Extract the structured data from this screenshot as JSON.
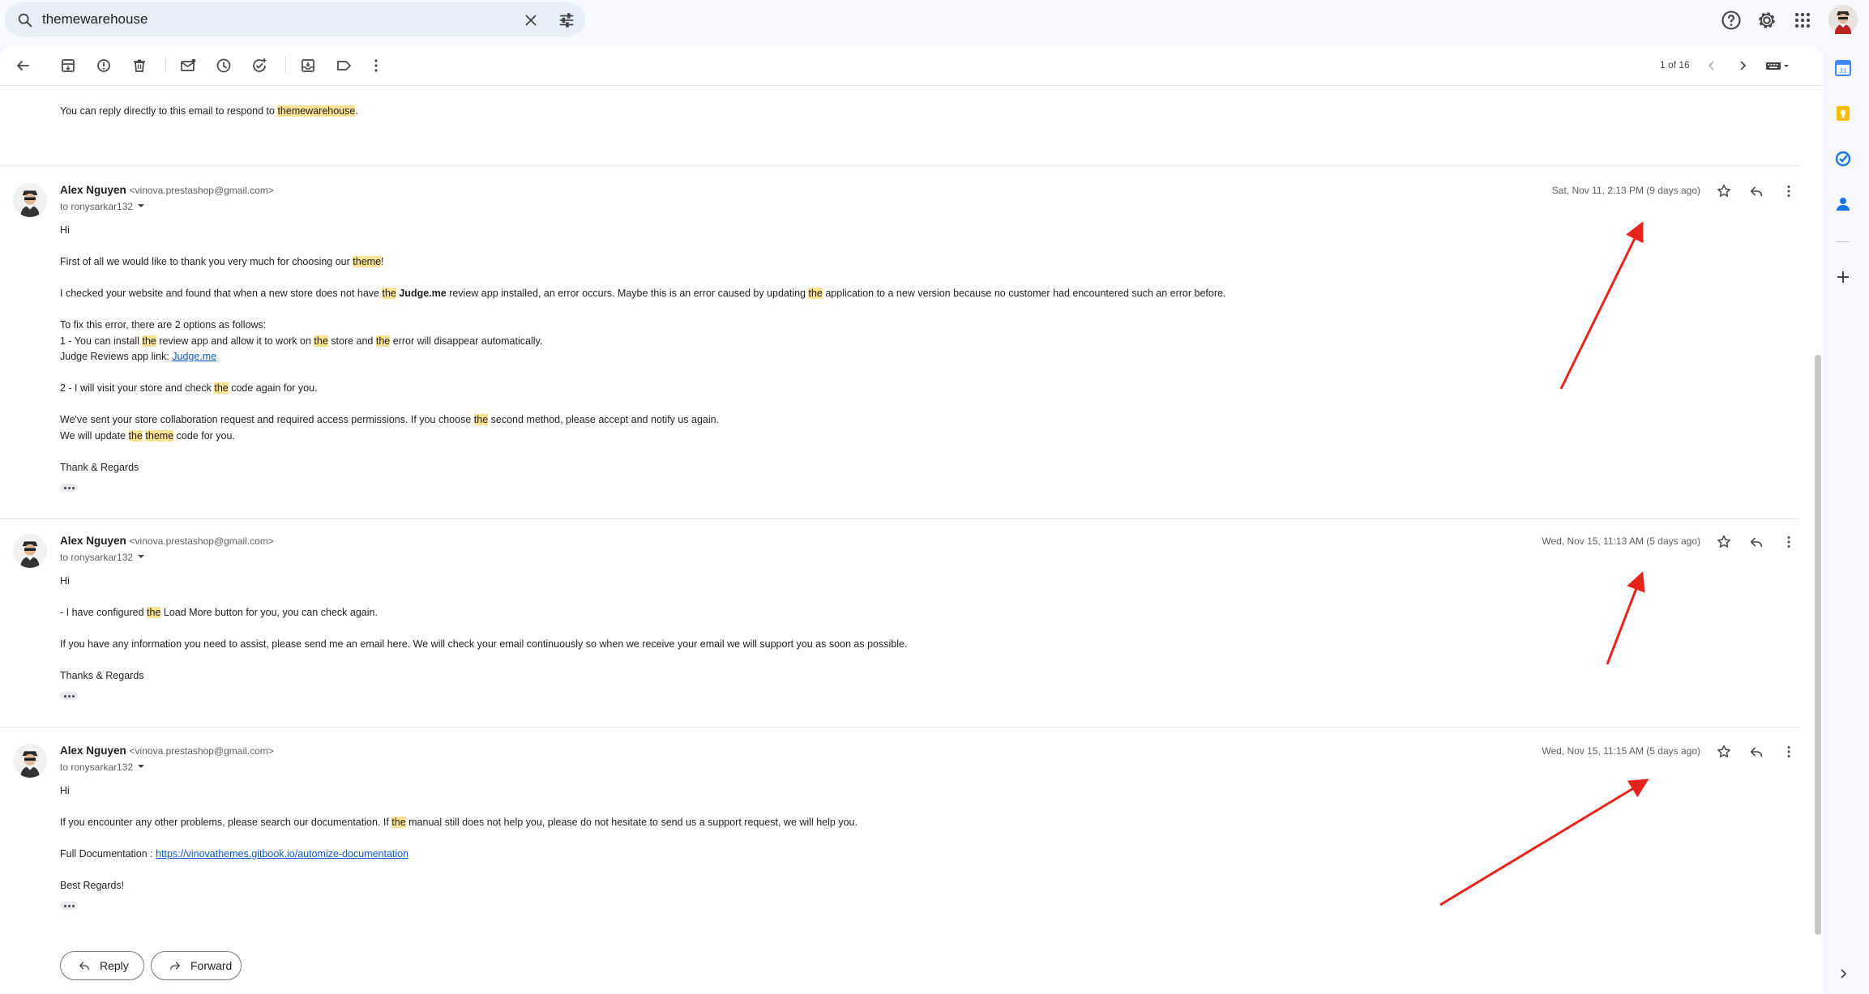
{
  "search": {
    "query": "themewarehouse"
  },
  "toolbar": {
    "pager": "1 of 16"
  },
  "colors": {
    "highlight": "#fde293",
    "link": "#0b57d0",
    "annotation_arrow": "#e8231c"
  },
  "intro": {
    "prefix": "You can reply directly to this email to respond to ",
    "keyword": "themewarehouse",
    "suffix": "."
  },
  "messages": [
    {
      "sender_name": "Alex Nguyen",
      "sender_email": "<vinova.prestashop@gmail.com>",
      "to": "to ronysarkar132",
      "date": "Sat, Nov 11, 2:13 PM (9 days ago)",
      "greeting": "Hi",
      "l1a": "First of all we would like to thank you very much for choosing our ",
      "l1b": "theme",
      "l1c": "!",
      "l2a": "I checked your website and found that when a new store does not have ",
      "l2b": "the",
      "l2c": " ",
      "l2d": "Judge.me",
      "l2e": " review app installed, an error occurs. Maybe this is an error caused by updating ",
      "l2f": "the",
      "l2g": " application to a new version because no customer had encountered such an error before.",
      "l3": "To fix this error, there are 2 options as follows:",
      "l4a": "1 - You can install ",
      "l4b": "the",
      "l4c": " review app and allow it to work on ",
      "l4d": "the",
      "l4e": " store and ",
      "l4f": "the",
      "l4g": " error will disappear automatically.",
      "l5a": "Judge Reviews app link: ",
      "l5b": "Judge.me",
      "l6a": "2 - I will visit your store and check ",
      "l6b": "the",
      "l6c": " code again for you.",
      "l7a": "We've sent your store collaboration request and required access permissions. If you choose ",
      "l7b": "the",
      "l7c": " second method, please accept and notify us again.",
      "l8a": "We will update ",
      "l8b": "the",
      "l8c": " ",
      "l8d": "theme",
      "l8e": " code for you.",
      "signoff": "Thank & Regards"
    },
    {
      "sender_name": "Alex Nguyen",
      "sender_email": "<vinova.prestashop@gmail.com>",
      "to": "to ronysarkar132",
      "date": "Wed, Nov 15, 11:13 AM (5 days ago)",
      "greeting": "Hi",
      "l1a": "- I have configured ",
      "l1b": "the",
      "l1c": " Load More button for you, you can check again.",
      "l2": "If you have any information you need to assist, please send me an email here. We will check your email continuously so when we receive your email we will support you as soon as possible.",
      "signoff": "Thanks & Regards"
    },
    {
      "sender_name": "Alex Nguyen",
      "sender_email": "<vinova.prestashop@gmail.com>",
      "to": "to ronysarkar132",
      "date": "Wed, Nov 15, 11:15 AM (5 days ago)",
      "greeting": "Hi",
      "l1a": "If you encounter any other problems, please search our documentation. If ",
      "l1b": "the",
      "l1c": " manual still does not help you, please do not hesitate to send us a support request, we will help you.",
      "l2a": "Full Documentation : ",
      "l2b": "https://vinovathemes.gitbook.io/automize-documentation",
      "signoff": "Best Regards!"
    }
  ],
  "actions": {
    "reply": "Reply",
    "forward": "Forward"
  }
}
